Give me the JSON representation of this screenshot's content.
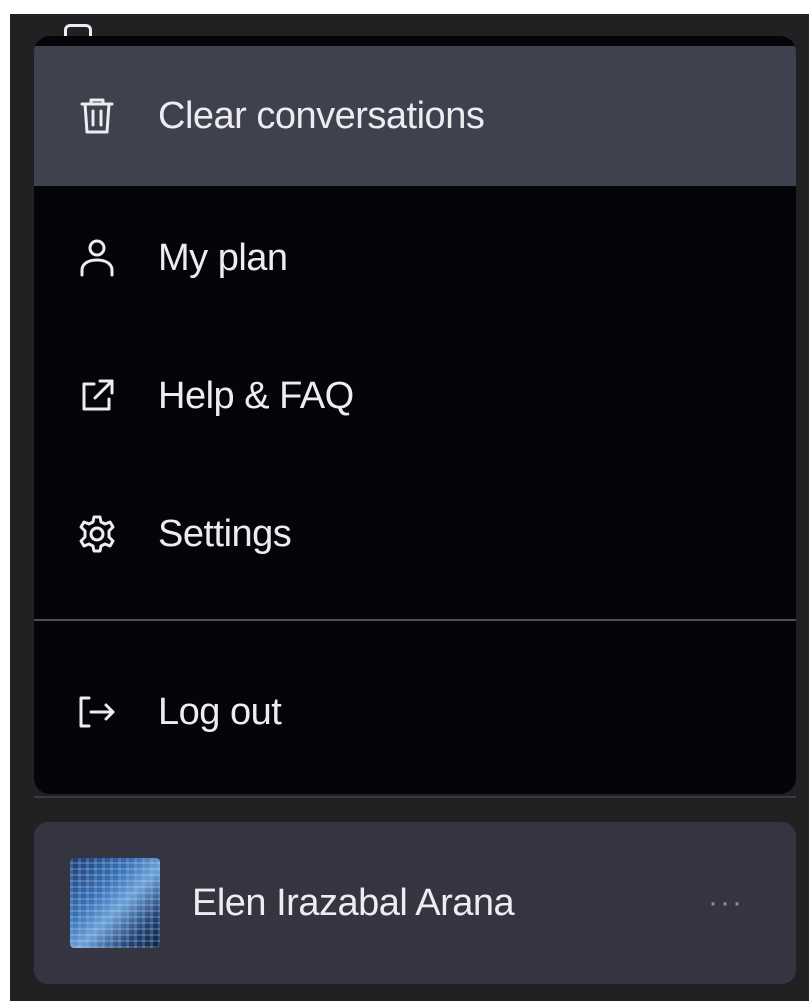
{
  "menu": {
    "items": [
      {
        "id": "clear",
        "label": "Clear conversations",
        "icon": "trash-icon",
        "active": true
      },
      {
        "id": "plan",
        "label": "My plan",
        "icon": "user-icon",
        "active": false
      },
      {
        "id": "help",
        "label": "Help & FAQ",
        "icon": "external-link-icon",
        "active": false
      },
      {
        "id": "settings",
        "label": "Settings",
        "icon": "gear-icon",
        "active": false
      },
      {
        "id": "logout",
        "label": "Log out",
        "icon": "logout-icon",
        "active": false
      }
    ]
  },
  "user": {
    "name": "Elen Irazabal Arana",
    "more_label": "···"
  },
  "colors": {
    "menu_bg": "#050509",
    "active_item_bg": "#40414f",
    "card_bg": "#343541",
    "text": "#ececf1",
    "muted": "#8e8ea0"
  }
}
